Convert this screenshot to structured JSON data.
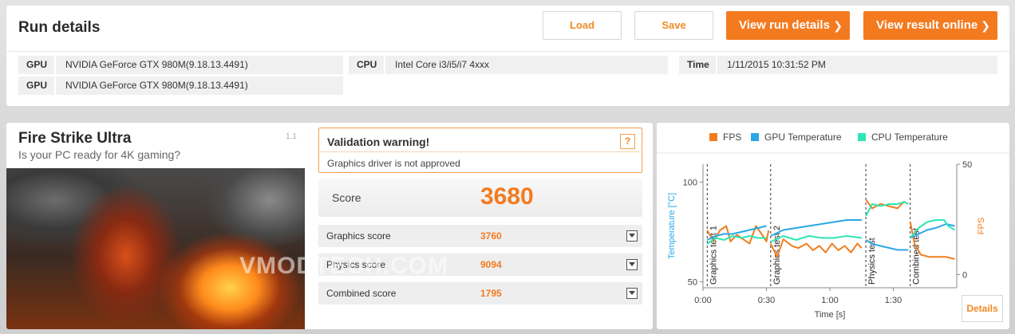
{
  "header": {
    "title": "Run details",
    "load_label": "Load",
    "save_label": "Save",
    "view_run_details_label": "View run details",
    "view_result_online_label": "View result online",
    "chevron": "❯"
  },
  "system_info": {
    "gpu_label": "GPU",
    "gpu1": "NVIDIA GeForce GTX 980M(9.18.13.4491)",
    "gpu2": "NVIDIA GeForce GTX 980M(9.18.13.4491)",
    "cpu_label": "CPU",
    "cpu": "Intel Core i3/i5/i7 4xxx",
    "time_label": "Time",
    "time": "1/11/2015 10:31:52 PM"
  },
  "benchmark": {
    "title": "Fire Strike Ultra",
    "subtitle": "Is your PC ready for 4K gaming?",
    "version": "1.1"
  },
  "warning": {
    "title": "Validation warning!",
    "help": "?",
    "message": "Graphics driver is not approved"
  },
  "score": {
    "label": "Score",
    "value": "3680"
  },
  "sub_scores": [
    {
      "label": "Graphics score",
      "value": "3760"
    },
    {
      "label": "Physics score",
      "value": "9094"
    },
    {
      "label": "Combined score",
      "value": "1795"
    }
  ],
  "watermark": "VMODTECH.COM",
  "details_label": "Details",
  "colors": {
    "accent": "#f47a20",
    "fps": "#f07d1e",
    "gpu_temp": "#2aa7e6",
    "cpu_temp": "#2fe6b4"
  },
  "chart_data": {
    "type": "line",
    "legend_position": "top",
    "xlabel": "Time [s]",
    "ylabel_left": "Temperature [°C]",
    "ylabel_right": "FPS",
    "x_ticks": [
      "0:00",
      "0:30",
      "1:00",
      "1:30"
    ],
    "y_left_ticks": [
      50,
      100
    ],
    "y_left_range": [
      47,
      109
    ],
    "y_right_ticks": [
      0,
      50
    ],
    "y_right_range": [
      -6,
      50
    ],
    "x_range": [
      0,
      120
    ],
    "grid": false,
    "markers": [
      {
        "label": "Graphics test 1",
        "x": 2
      },
      {
        "label": "Graphics test 2",
        "x": 32
      },
      {
        "label": "Physics test",
        "x": 77
      },
      {
        "label": "Combined test",
        "x": 98
      }
    ],
    "series": [
      {
        "name": "FPS",
        "axis": "right",
        "segments": [
          [
            [
              2,
              20
            ],
            [
              5,
              15
            ],
            [
              8,
              20
            ],
            [
              11,
              22
            ],
            [
              13,
              15
            ],
            [
              16,
              18
            ],
            [
              19,
              16
            ],
            [
              22,
              14
            ],
            [
              25,
              22
            ],
            [
              28,
              18
            ],
            [
              30,
              15
            ],
            [
              31,
              20
            ]
          ],
          [
            [
              32,
              14
            ],
            [
              35,
              8
            ],
            [
              38,
              16
            ],
            [
              42,
              13
            ],
            [
              45,
              12
            ],
            [
              49,
              14
            ],
            [
              52,
              11
            ],
            [
              55,
              13
            ],
            [
              58,
              10
            ],
            [
              61,
              14
            ],
            [
              64,
              11
            ],
            [
              67,
              13
            ],
            [
              70,
              10
            ],
            [
              73,
              14
            ],
            [
              75,
              12
            ]
          ],
          [
            [
              77,
              34
            ],
            [
              80,
              30
            ],
            [
              84,
              32
            ],
            [
              88,
              31
            ],
            [
              92,
              30
            ],
            [
              95,
              33
            ],
            [
              97,
              32
            ]
          ],
          [
            [
              98,
              24
            ],
            [
              100,
              14
            ],
            [
              103,
              9
            ],
            [
              107,
              8
            ],
            [
              111,
              8
            ],
            [
              115,
              8
            ],
            [
              119,
              7
            ]
          ]
        ]
      },
      {
        "name": "GPU Temperature",
        "axis": "left",
        "segments": [
          [
            [
              2,
              71
            ],
            [
              6,
              73
            ],
            [
              10,
              74
            ],
            [
              14,
              74
            ],
            [
              18,
              75
            ],
            [
              22,
              76
            ],
            [
              26,
              77
            ],
            [
              30,
              78
            ]
          ],
          [
            [
              32,
              73
            ],
            [
              38,
              76
            ],
            [
              44,
              77
            ],
            [
              50,
              78
            ],
            [
              56,
              79
            ],
            [
              62,
              80
            ],
            [
              68,
              81
            ],
            [
              75,
              81
            ]
          ],
          [
            [
              77,
              71
            ],
            [
              80,
              69
            ],
            [
              84,
              68
            ],
            [
              88,
              67
            ],
            [
              92,
              66
            ],
            [
              97,
              66
            ]
          ],
          [
            [
              98,
              72
            ],
            [
              102,
              74
            ],
            [
              106,
              76
            ],
            [
              110,
              77
            ],
            [
              115,
              79
            ],
            [
              119,
              78
            ]
          ]
        ]
      },
      {
        "name": "CPU Temperature",
        "axis": "left",
        "segments": [
          [
            [
              2,
              69
            ],
            [
              6,
              72
            ],
            [
              10,
              71
            ],
            [
              14,
              73
            ],
            [
              18,
              72
            ],
            [
              22,
              73
            ],
            [
              26,
              72
            ],
            [
              30,
              72
            ]
          ],
          [
            [
              32,
              70
            ],
            [
              38,
              73
            ],
            [
              44,
              71
            ],
            [
              50,
              73
            ],
            [
              56,
              72
            ],
            [
              62,
              72
            ],
            [
              68,
              73
            ],
            [
              75,
              72
            ]
          ],
          [
            [
              77,
              83
            ],
            [
              80,
              89
            ],
            [
              84,
              88
            ],
            [
              88,
              89
            ],
            [
              92,
              89
            ],
            [
              95,
              90
            ],
            [
              97,
              89
            ]
          ],
          [
            [
              98,
              72
            ],
            [
              102,
              77
            ],
            [
              106,
              80
            ],
            [
              110,
              81
            ],
            [
              114,
              81
            ],
            [
              116,
              78
            ],
            [
              119,
              76
            ]
          ]
        ]
      }
    ]
  }
}
